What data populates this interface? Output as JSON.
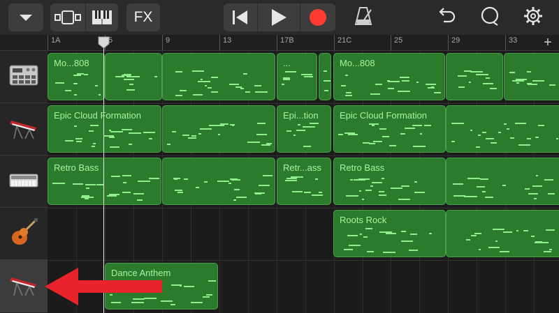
{
  "toolbar": {
    "fx_label": "FX",
    "buttons": [
      "chevron-down-icon",
      "view-toggle-icon",
      "keyboard-icon",
      "fx",
      "rewind-icon",
      "play-icon",
      "record-icon",
      "metronome-icon",
      "undo-icon",
      "tempo-loop-icon",
      "settings-gear-icon"
    ]
  },
  "ruler": {
    "labels": [
      {
        "text": "1A"
      },
      {
        "text": "5"
      },
      {
        "text": "9"
      },
      {
        "text": "13"
      },
      {
        "text": "17B"
      },
      {
        "text": "21C"
      },
      {
        "text": "25"
      },
      {
        "text": "29"
      },
      {
        "text": "33"
      }
    ]
  },
  "tracks": [
    {
      "instrument": "drum-machine-icon",
      "selected": false
    },
    {
      "instrument": "keyboard-synth-icon",
      "selected": false
    },
    {
      "instrument": "synth-bass-icon",
      "selected": false
    },
    {
      "instrument": "guitar-icon",
      "selected": false
    },
    {
      "instrument": "keyboard-synth-icon",
      "selected": true
    }
  ],
  "regions": [
    {
      "name": "Mo...808",
      "track": 0
    },
    {
      "name": "",
      "track": 0
    },
    {
      "name": "",
      "track": 0
    },
    {
      "name": "...",
      "track": 0
    },
    {
      "name": "",
      "track": 0
    },
    {
      "name": "Mo...808",
      "track": 0
    },
    {
      "name": "",
      "track": 0
    },
    {
      "name": "",
      "track": 0
    },
    {
      "name": "Epic Cloud Formation",
      "track": 1
    },
    {
      "name": "",
      "track": 1
    },
    {
      "name": "Epi...tion",
      "track": 1
    },
    {
      "name": "Epic Cloud Formation",
      "track": 1
    },
    {
      "name": "",
      "track": 1
    },
    {
      "name": "Retro Bass",
      "track": 2
    },
    {
      "name": "",
      "track": 2
    },
    {
      "name": "Retr...ass",
      "track": 2
    },
    {
      "name": "Retro Bass",
      "track": 2
    },
    {
      "name": "",
      "track": 2
    },
    {
      "name": "Roots Rock",
      "track": 3
    },
    {
      "name": "",
      "track": 3
    },
    {
      "name": "Dance Anthem",
      "track": 4
    }
  ],
  "colors": {
    "region_fill": "#2c7a2c",
    "region_border": "#4ba04b",
    "region_text": "#a6f5a0",
    "note": "#8ef08a",
    "record": "#ff3b30",
    "arrow": "#e8232b"
  },
  "add_track_label": "+"
}
